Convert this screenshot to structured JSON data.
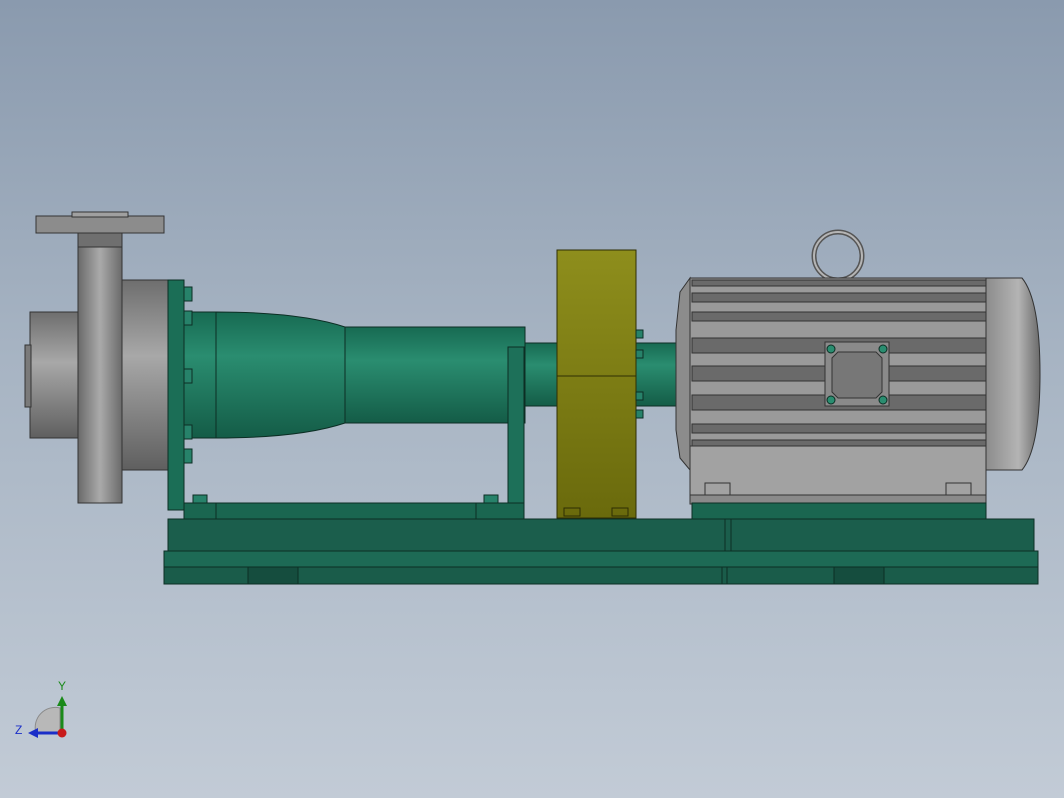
{
  "viewport": {
    "background_top": "#8a9aae",
    "background_bottom": "#c2cbd6"
  },
  "model": {
    "components": [
      "pump-casing",
      "bearing-frame",
      "coupling-guard",
      "electric-motor",
      "base-frame"
    ],
    "colors": {
      "pump_green": "#1e7b63",
      "casing_gray": "#8a8a8a",
      "coupling_olive": "#7a7a10",
      "motor_gray": "#9a9a9a",
      "base_green": "#1b5e4c"
    }
  },
  "triad": {
    "x_label": "",
    "y_label": "Y",
    "z_label": "Z",
    "y_color": "#1a8a1a",
    "z_color": "#1a2ec8",
    "x_color": "#c81a1a"
  }
}
